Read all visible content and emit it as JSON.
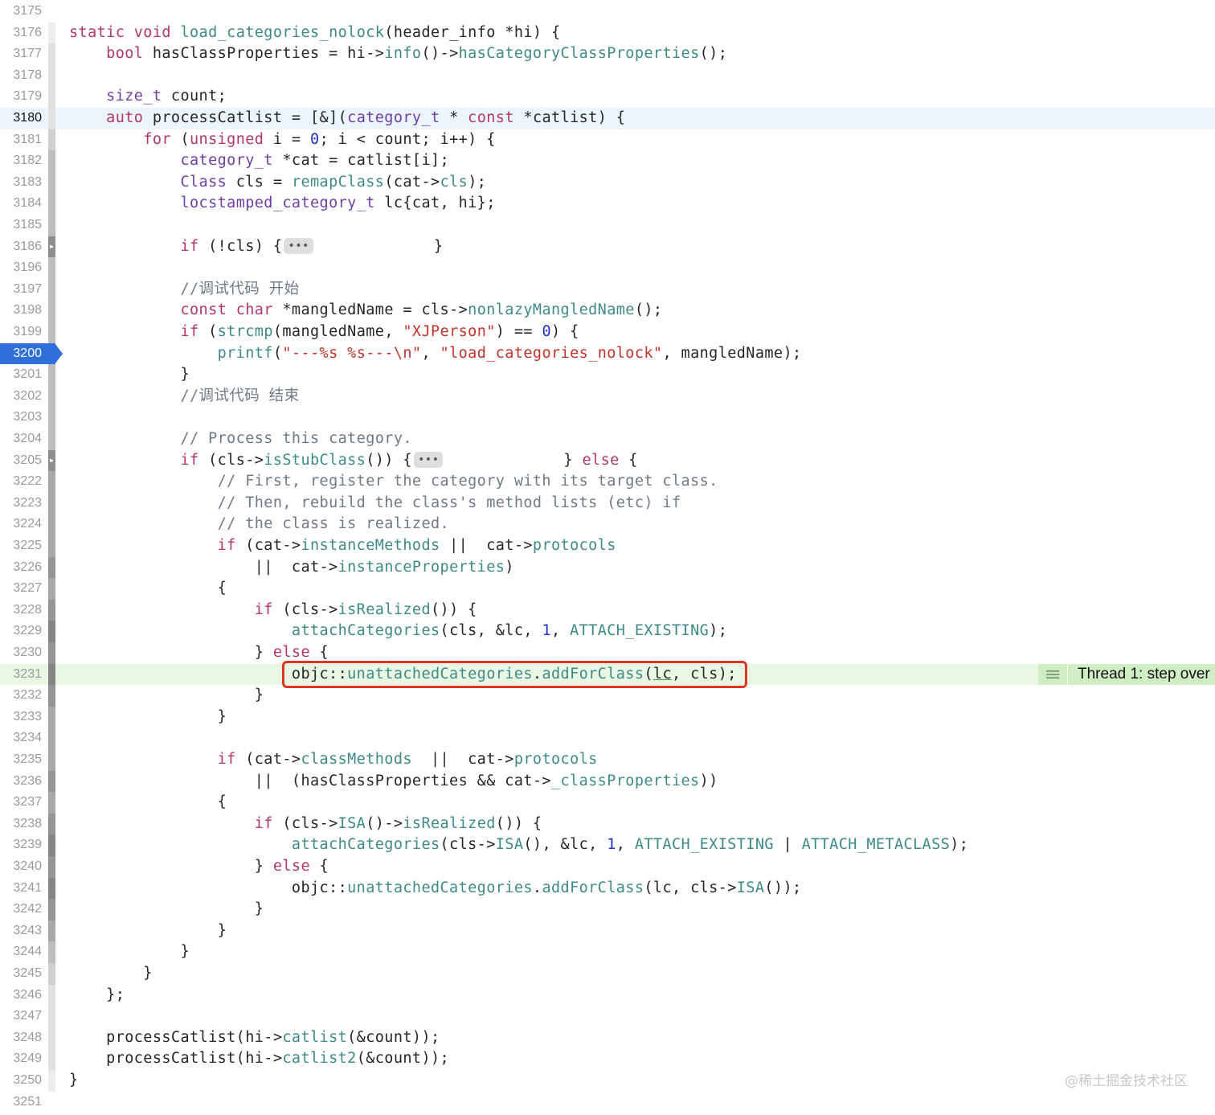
{
  "editor": {
    "lines": [
      {
        "n": "3175",
        "tokens": []
      },
      {
        "n": "3176",
        "tokens": [
          [
            "kw",
            "static void "
          ],
          [
            "fn",
            "load_categories_nolock"
          ],
          [
            "pl",
            "(header_info *hi) {"
          ]
        ]
      },
      {
        "n": "3177",
        "tokens": [
          [
            "pl",
            "    "
          ],
          [
            "kw",
            "bool"
          ],
          [
            "pl",
            " hasClassProperties = hi->"
          ],
          [
            "fn",
            "info"
          ],
          [
            "pl",
            "()->"
          ],
          [
            "fn",
            "hasCategoryClassProperties"
          ],
          [
            "pl",
            "();"
          ]
        ]
      },
      {
        "n": "3178",
        "tokens": []
      },
      {
        "n": "3179",
        "tokens": [
          [
            "pl",
            "    "
          ],
          [
            "ty",
            "size_t"
          ],
          [
            "pl",
            " count;"
          ]
        ]
      },
      {
        "n": "3180",
        "tokens": [
          [
            "pl",
            "    "
          ],
          [
            "kw",
            "auto"
          ],
          [
            "pl",
            " processCatlist = [&]("
          ],
          [
            "ty",
            "category_t"
          ],
          [
            "pl",
            " * "
          ],
          [
            "kw",
            "const"
          ],
          [
            "pl",
            " *catlist) {"
          ]
        ]
      },
      {
        "n": "3181",
        "tokens": [
          [
            "pl",
            "        "
          ],
          [
            "kw",
            "for"
          ],
          [
            "pl",
            " ("
          ],
          [
            "kw",
            "unsigned"
          ],
          [
            "pl",
            " i = "
          ],
          [
            "num",
            "0"
          ],
          [
            "pl",
            "; i < count; i++) {"
          ]
        ]
      },
      {
        "n": "3182",
        "tokens": [
          [
            "pl",
            "            "
          ],
          [
            "ty",
            "category_t"
          ],
          [
            "pl",
            " *cat = catlist[i];"
          ]
        ]
      },
      {
        "n": "3183",
        "tokens": [
          [
            "pl",
            "            "
          ],
          [
            "ty",
            "Class"
          ],
          [
            "pl",
            " cls = "
          ],
          [
            "fn",
            "remapClass"
          ],
          [
            "pl",
            "(cat->"
          ],
          [
            "fn",
            "cls"
          ],
          [
            "pl",
            ");"
          ]
        ]
      },
      {
        "n": "3184",
        "tokens": [
          [
            "pl",
            "            "
          ],
          [
            "ty",
            "locstamped_category_t"
          ],
          [
            "pl",
            " lc{cat, hi};"
          ]
        ]
      },
      {
        "n": "3185",
        "tokens": []
      },
      {
        "n": "3186",
        "tokens": [
          [
            "pl",
            "            "
          ],
          [
            "kw",
            "if"
          ],
          [
            "pl",
            " (!cls) {"
          ],
          [
            "fold",
            "•••"
          ],
          [
            "pl",
            "             }"
          ]
        ]
      },
      {
        "n": "3196",
        "tokens": []
      },
      {
        "n": "3197",
        "tokens": [
          [
            "pl",
            "            "
          ],
          [
            "cm",
            "//调试代码 开始"
          ]
        ]
      },
      {
        "n": "3198",
        "tokens": [
          [
            "pl",
            "            "
          ],
          [
            "kw",
            "const char"
          ],
          [
            "pl",
            " *mangledName = cls->"
          ],
          [
            "fn",
            "nonlazyMangledName"
          ],
          [
            "pl",
            "();"
          ]
        ]
      },
      {
        "n": "3199",
        "tokens": [
          [
            "pl",
            "            "
          ],
          [
            "kw",
            "if"
          ],
          [
            "pl",
            " ("
          ],
          [
            "fn",
            "strcmp"
          ],
          [
            "pl",
            "(mangledName, "
          ],
          [
            "str",
            "\"XJPerson\""
          ],
          [
            "pl",
            ") == "
          ],
          [
            "num",
            "0"
          ],
          [
            "pl",
            ") {"
          ]
        ]
      },
      {
        "n": "3200",
        "tokens": [
          [
            "pl",
            "                "
          ],
          [
            "fn",
            "printf"
          ],
          [
            "pl",
            "("
          ],
          [
            "str",
            "\"---%s %s---\\n\""
          ],
          [
            "pl",
            ", "
          ],
          [
            "str",
            "\"load_categories_nolock\""
          ],
          [
            "pl",
            ", mangledName);"
          ]
        ]
      },
      {
        "n": "3201",
        "tokens": [
          [
            "pl",
            "            }"
          ]
        ]
      },
      {
        "n": "3202",
        "tokens": [
          [
            "pl",
            "            "
          ],
          [
            "cm",
            "//调试代码 结束"
          ]
        ]
      },
      {
        "n": "3203",
        "tokens": []
      },
      {
        "n": "3204",
        "tokens": [
          [
            "pl",
            "            "
          ],
          [
            "cm",
            "// Process this category."
          ]
        ]
      },
      {
        "n": "3205",
        "tokens": [
          [
            "pl",
            "            "
          ],
          [
            "kw",
            "if"
          ],
          [
            "pl",
            " (cls->"
          ],
          [
            "fn",
            "isStubClass"
          ],
          [
            "pl",
            "()) {"
          ],
          [
            "fold",
            "•••"
          ],
          [
            "pl",
            "             } "
          ],
          [
            "kw",
            "else"
          ],
          [
            "pl",
            " {"
          ]
        ]
      },
      {
        "n": "3222",
        "tokens": [
          [
            "pl",
            "                "
          ],
          [
            "cm",
            "// First, register the category with its target class."
          ]
        ]
      },
      {
        "n": "3223",
        "tokens": [
          [
            "pl",
            "                "
          ],
          [
            "cm",
            "// Then, rebuild the class's method lists (etc) if"
          ]
        ]
      },
      {
        "n": "3224",
        "tokens": [
          [
            "pl",
            "                "
          ],
          [
            "cm",
            "// the class is realized."
          ]
        ]
      },
      {
        "n": "3225",
        "tokens": [
          [
            "pl",
            "                "
          ],
          [
            "kw",
            "if"
          ],
          [
            "pl",
            " (cat->"
          ],
          [
            "fn",
            "instanceMethods"
          ],
          [
            "pl",
            " ||  cat->"
          ],
          [
            "fn",
            "protocols"
          ]
        ]
      },
      {
        "n": "3226",
        "tokens": [
          [
            "pl",
            "                    ||  cat->"
          ],
          [
            "fn",
            "instanceProperties"
          ],
          [
            "pl",
            ")"
          ]
        ]
      },
      {
        "n": "3227",
        "tokens": [
          [
            "pl",
            "                {"
          ]
        ]
      },
      {
        "n": "3228",
        "tokens": [
          [
            "pl",
            "                    "
          ],
          [
            "kw",
            "if"
          ],
          [
            "pl",
            " (cls->"
          ],
          [
            "fn",
            "isRealized"
          ],
          [
            "pl",
            "()) {"
          ]
        ]
      },
      {
        "n": "3229",
        "tokens": [
          [
            "pl",
            "                        "
          ],
          [
            "fn",
            "attachCategories"
          ],
          [
            "pl",
            "(cls, &lc, "
          ],
          [
            "num",
            "1"
          ],
          [
            "pl",
            ", "
          ],
          [
            "fn",
            "ATTACH_EXISTING"
          ],
          [
            "pl",
            ");"
          ]
        ]
      },
      {
        "n": "3230",
        "tokens": [
          [
            "pl",
            "                    } "
          ],
          [
            "kw",
            "else"
          ],
          [
            "pl",
            " {"
          ]
        ]
      },
      {
        "n": "3231",
        "tokens": [
          [
            "pl",
            "                        objc::"
          ],
          [
            "fn",
            "unattachedCategories"
          ],
          [
            "pl",
            "."
          ],
          [
            "fn",
            "addForClass"
          ],
          [
            "pl",
            "("
          ],
          [
            "under",
            "lc"
          ],
          [
            "pl",
            ", cls);"
          ]
        ]
      },
      {
        "n": "3232",
        "tokens": [
          [
            "pl",
            "                    }"
          ]
        ]
      },
      {
        "n": "3233",
        "tokens": [
          [
            "pl",
            "                }"
          ]
        ]
      },
      {
        "n": "3234",
        "tokens": []
      },
      {
        "n": "3235",
        "tokens": [
          [
            "pl",
            "                "
          ],
          [
            "kw",
            "if"
          ],
          [
            "pl",
            " (cat->"
          ],
          [
            "fn",
            "classMethods"
          ],
          [
            "pl",
            "  ||  cat->"
          ],
          [
            "fn",
            "protocols"
          ]
        ]
      },
      {
        "n": "3236",
        "tokens": [
          [
            "pl",
            "                    ||  (hasClassProperties && cat->"
          ],
          [
            "fn",
            "_classProperties"
          ],
          [
            "pl",
            "))"
          ]
        ]
      },
      {
        "n": "3237",
        "tokens": [
          [
            "pl",
            "                {"
          ]
        ]
      },
      {
        "n": "3238",
        "tokens": [
          [
            "pl",
            "                    "
          ],
          [
            "kw",
            "if"
          ],
          [
            "pl",
            " (cls->"
          ],
          [
            "fn",
            "ISA"
          ],
          [
            "pl",
            "()->"
          ],
          [
            "fn",
            "isRealized"
          ],
          [
            "pl",
            "()) {"
          ]
        ]
      },
      {
        "n": "3239",
        "tokens": [
          [
            "pl",
            "                        "
          ],
          [
            "fn",
            "attachCategories"
          ],
          [
            "pl",
            "(cls->"
          ],
          [
            "fn",
            "ISA"
          ],
          [
            "pl",
            "(), &lc, "
          ],
          [
            "num",
            "1"
          ],
          [
            "pl",
            ", "
          ],
          [
            "fn",
            "ATTACH_EXISTING"
          ],
          [
            "pl",
            " | "
          ],
          [
            "fn",
            "ATTACH_METACLASS"
          ],
          [
            "pl",
            ");"
          ]
        ]
      },
      {
        "n": "3240",
        "tokens": [
          [
            "pl",
            "                    } "
          ],
          [
            "kw",
            "else"
          ],
          [
            "pl",
            " {"
          ]
        ]
      },
      {
        "n": "3241",
        "tokens": [
          [
            "pl",
            "                        objc::"
          ],
          [
            "fn",
            "unattachedCategories"
          ],
          [
            "pl",
            "."
          ],
          [
            "fn",
            "addForClass"
          ],
          [
            "pl",
            "(lc, cls->"
          ],
          [
            "fn",
            "ISA"
          ],
          [
            "pl",
            "());"
          ]
        ]
      },
      {
        "n": "3242",
        "tokens": [
          [
            "pl",
            "                    }"
          ]
        ]
      },
      {
        "n": "3243",
        "tokens": [
          [
            "pl",
            "                }"
          ]
        ]
      },
      {
        "n": "3244",
        "tokens": [
          [
            "pl",
            "            }"
          ]
        ]
      },
      {
        "n": "3245",
        "tokens": [
          [
            "pl",
            "        }"
          ]
        ]
      },
      {
        "n": "3246",
        "tokens": [
          [
            "pl",
            "    };"
          ]
        ]
      },
      {
        "n": "3247",
        "tokens": []
      },
      {
        "n": "3248",
        "tokens": [
          [
            "pl",
            "    processCatlist(hi->"
          ],
          [
            "fn",
            "catlist"
          ],
          [
            "pl",
            "(&count));"
          ]
        ]
      },
      {
        "n": "3249",
        "tokens": [
          [
            "pl",
            "    processCatlist(hi->"
          ],
          [
            "fn",
            "catlist2"
          ],
          [
            "pl",
            "(&count));"
          ]
        ]
      },
      {
        "n": "3250",
        "tokens": [
          [
            "pl",
            "}"
          ]
        ]
      },
      {
        "n": "3251",
        "tokens": []
      }
    ],
    "current_line": "3180",
    "breakpoint_line": "3200",
    "highlighted_line": "3231",
    "folded_lines": [
      "3186",
      "3205"
    ],
    "thread_badge": {
      "label": "Thread 1: step over",
      "icon": "lines-icon"
    },
    "colors": {
      "keyword": "#b3366b",
      "type": "#6e3fa6",
      "function": "#3d8a87",
      "string": "#c4322a",
      "number": "#1f31c9",
      "comment": "#6f7a85",
      "breakpoint": "#2f6fd9",
      "highlight_box": "#e2341f",
      "step_line": "#e9f7e3",
      "badge": "#cfeec4"
    }
  },
  "watermark": "@稀土掘金技术社区"
}
